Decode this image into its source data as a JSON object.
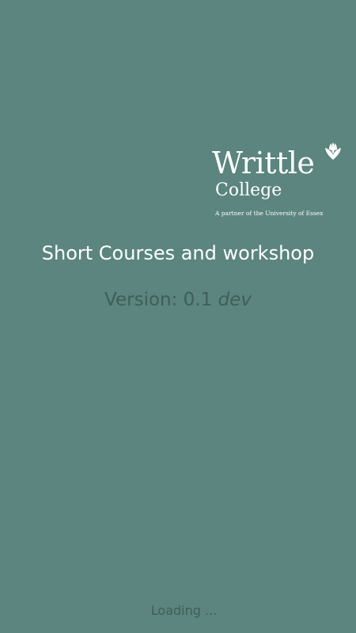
{
  "splash": {
    "logo": {
      "name": "Writtle",
      "sub": "College",
      "tagline": "A partner of the University of Essex",
      "icon": "leaf-icon"
    },
    "title": "Short Courses and workshop",
    "version_label": "Version: 0.1",
    "version_channel": "dev",
    "loading_text": "Loading ...",
    "colors": {
      "background": "#5b857e",
      "title_text": "#ffffff",
      "muted_text": "#3f5e59"
    }
  }
}
